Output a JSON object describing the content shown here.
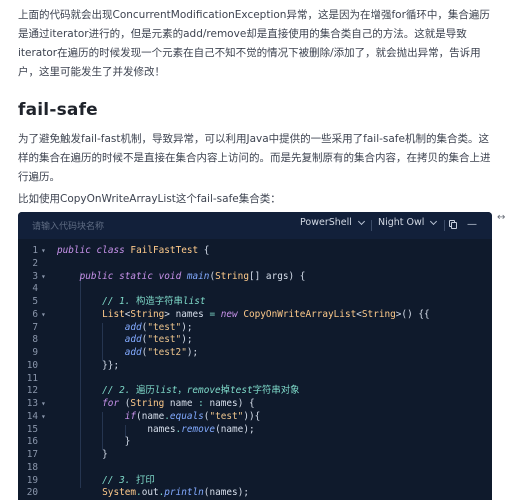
{
  "paragraphs": [
    "上面的代码就会出现ConcurrentModificationException异常，这是因为在增强for循环中，集合遍历是通过iterator进行的，但是元素的add/remove却是直接使用的集合类自己的方法。这就是导致iterator在遍历的时候发现一个元素在自己不知不觉的情况下被删除/添加了，就会抛出异常，告诉用户，这里可能发生了并发修改！",
    "为了避免触发fail-fast机制，导致异常，可以利用Java中提供的一些采用了fail-safe机制的集合类。这样的集合在遍历的时候不是直接在集合内容上访问的。而是先复制原有的集合内容，在拷贝的集合上进行遍历。",
    "比如使用CopyOnWriteArrayList这个fail-safe集合类："
  ],
  "heading": "fail-safe",
  "editor": {
    "search_placeholder": "请输入代码块名称",
    "language": "PowerShell",
    "theme": "Night Owl",
    "expand_glyph": "↔",
    "minus_glyph": "—"
  },
  "code": {
    "lines": [
      {
        "n": "1",
        "fold": "▾",
        "text": "public class FailFastTest {"
      },
      {
        "n": "2",
        "fold": "",
        "text": ""
      },
      {
        "n": "3",
        "fold": "▾",
        "text": "    public static void main(String[] args) {"
      },
      {
        "n": "4",
        "fold": "",
        "text": ""
      },
      {
        "n": "5",
        "fold": "",
        "text": "        // 1. 构造字符串list"
      },
      {
        "n": "6",
        "fold": "▾",
        "text": "        List<String> names = new CopyOnWriteArrayList<String>() {{"
      },
      {
        "n": "7",
        "fold": "",
        "text": "            add(\"test\");"
      },
      {
        "n": "8",
        "fold": "",
        "text": "            add(\"test\");"
      },
      {
        "n": "9",
        "fold": "",
        "text": "            add(\"test2\");"
      },
      {
        "n": "10",
        "fold": "",
        "text": "        }};"
      },
      {
        "n": "11",
        "fold": "",
        "text": ""
      },
      {
        "n": "12",
        "fold": "",
        "text": "        // 2. 遍历list，remove掉test字符串对象"
      },
      {
        "n": "13",
        "fold": "▾",
        "text": "        for (String name : names) {"
      },
      {
        "n": "14",
        "fold": "▾",
        "text": "            if(name.equals(\"test\")){"
      },
      {
        "n": "15",
        "fold": "",
        "text": "                names.remove(name);"
      },
      {
        "n": "16",
        "fold": "",
        "text": "            }"
      },
      {
        "n": "17",
        "fold": "",
        "text": "        }"
      },
      {
        "n": "18",
        "fold": "",
        "text": ""
      },
      {
        "n": "19",
        "fold": "",
        "text": "        // 3. 打印"
      },
      {
        "n": "20",
        "fold": "",
        "text": "        System.out.println(names);"
      }
    ]
  }
}
